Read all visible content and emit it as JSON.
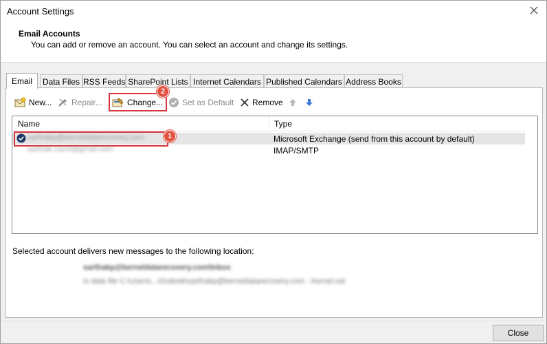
{
  "window": {
    "title": "Account Settings",
    "close_glyph": "✕"
  },
  "header": {
    "title": "Email Accounts",
    "description": "You can add or remove an account. You can select an account and change its settings."
  },
  "tabs": [
    {
      "label": "Email",
      "active": true
    },
    {
      "label": "Data Files"
    },
    {
      "label": "RSS Feeds"
    },
    {
      "label": "SharePoint Lists"
    },
    {
      "label": "Internet Calendars"
    },
    {
      "label": "Published Calendars"
    },
    {
      "label": "Address Books"
    }
  ],
  "toolbar": {
    "new_label": "New...",
    "repair_label": "Repair...",
    "change_label": "Change...",
    "set_default_label": "Set as Default",
    "remove_label": "Remove"
  },
  "list": {
    "columns": [
      "Name",
      "Type"
    ],
    "rows": [
      {
        "name": "sarthakp@kerneldatarecovery.com",
        "type": "Microsoft Exchange (send from this account by default)",
        "default": true
      },
      {
        "name": "sarthak.na24@gmail.com",
        "type": "IMAP/SMTP"
      }
    ]
  },
  "badges": {
    "account": "1",
    "change": "2"
  },
  "delivery": {
    "label": "Selected account delivers new messages to the following location:",
    "location": "sarthakp@kerneldatarecovery.com\\Inbox",
    "data_file": "in data file C:\\Users\\...\\Outlook\\sarthakp@kerneldatarecovery.com - Kernel.ost"
  },
  "footer": {
    "close_label": "Close"
  },
  "colors": {
    "highlight": "#d9363e",
    "badge": "#e0513f"
  },
  "icons": {
    "new": "envelope-new-icon",
    "repair": "tools-icon",
    "change": "change-icon",
    "set_default": "check-circle-icon",
    "remove": "x-icon",
    "move_up": "arrow-up-icon",
    "move_down": "arrow-down-icon"
  }
}
